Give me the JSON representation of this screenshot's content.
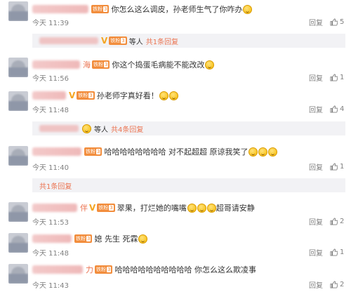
{
  "comments": [
    {
      "name_tail": "",
      "text": "你怎么这么调皮，孙老师生气了你咋办",
      "time": "今天 11:39",
      "reply": "回复",
      "likes": "5"
    },
    {
      "sub": {
        "who": "等人",
        "more": "共1条回复"
      }
    },
    {
      "name_tail": "海",
      "text": "你这个捣蛋毛病能不能改改",
      "time": "今天 11:56",
      "reply": "回复",
      "likes": "1"
    },
    {
      "name_tail": "",
      "text": "孙老师字真好看！",
      "time": "今天 11:48",
      "reply": "回复",
      "likes": "4"
    },
    {
      "sub": {
        "who": "等人",
        "more": "共4条回复"
      }
    },
    {
      "name_tail": "",
      "text": "哈哈哈哈哈哈哈哈 对不起超超 原谅我笑了",
      "time": "今天 11:40",
      "reply": "回复",
      "likes": "1"
    },
    {
      "sub": {
        "who": "",
        "more": "共1条回复"
      }
    },
    {
      "name_tail": "伴",
      "text": "翠果，打烂她的嘴嘴",
      "text2": "超哥请安静",
      "time": "今天 11:53",
      "reply": "回复",
      "likes": "2"
    },
    {
      "name_tail": "",
      "text": "媳 先生 死霖",
      "time": "今天 11:48",
      "reply": "回复",
      "likes": "1"
    },
    {
      "name_tail": "力",
      "text": "哈哈哈哈哈哈哈哈哈哈 你怎么这么欺凌事",
      "time": "今天 11:43",
      "reply": "回复",
      "likes": "2"
    }
  ],
  "badge": {
    "fan_label": "铁粉",
    "level": "3"
  },
  "icons": {
    "like": "thumbs-up-icon",
    "emoji": "smiley-emoji-icon",
    "vip": "crown-icon"
  },
  "colors": {
    "accent": "#eb7350",
    "badge": "#f28d3c",
    "vip": "#f5a623",
    "meta": "#808080",
    "subrow_bg": "#f2f2f5"
  }
}
